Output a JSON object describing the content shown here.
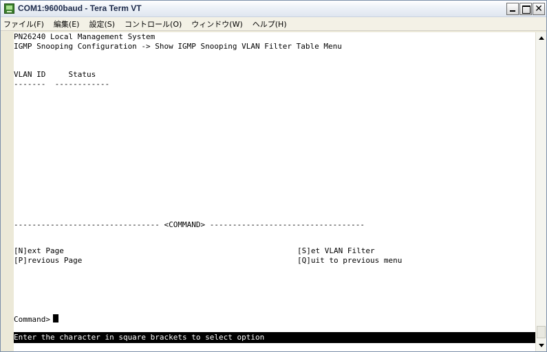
{
  "window": {
    "title": "COM1:9600baud - Tera Term VT"
  },
  "menu": [
    "ファイル(F)",
    "編集(E)",
    "設定(S)",
    "コントロール(O)",
    "ウィンドウ(W)",
    "ヘルプ(H)"
  ],
  "terminal": {
    "header1": "PN26240 Local Management System",
    "header2": "IGMP Snooping Configuration -> Show IGMP Snooping VLAN Filter Table Menu",
    "column_headers": "VLAN ID     Status",
    "column_underline": "-------  ------------",
    "command_divider": "-------------------------------- <COMMAND> ----------------------------------",
    "commands_left": [
      "[N]ext Page",
      "[P]revious Page"
    ],
    "commands_right": [
      "[S]et VLAN Filter",
      "[Q]uit to previous menu"
    ],
    "prompt": "Command>",
    "status": "Enter the character in square brackets to select option"
  }
}
